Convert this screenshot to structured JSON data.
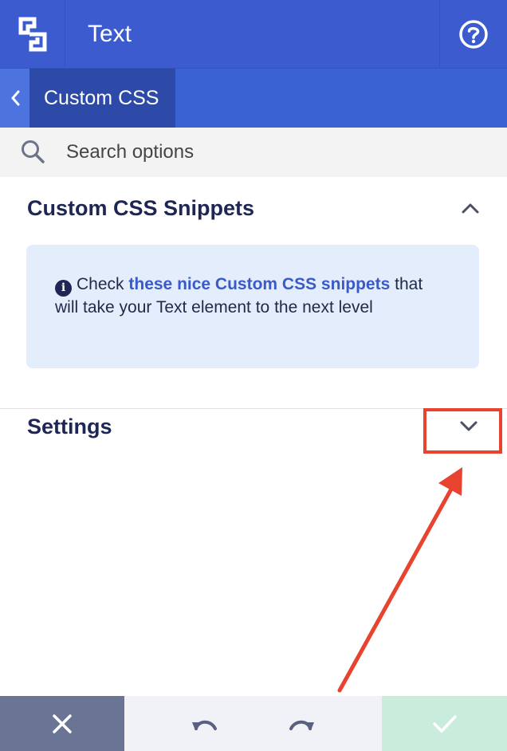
{
  "header": {
    "title": "Text",
    "logo_icon": "builder-logo-icon",
    "help_icon": "help-circle-icon"
  },
  "breadcrumb": {
    "back_icon": "chevron-left-icon",
    "current": "Custom CSS"
  },
  "search": {
    "placeholder": "Search options",
    "value": ""
  },
  "sections": {
    "snippets": {
      "title": "Custom CSS Snippets",
      "toggle_icon": "chevron-up-icon",
      "info": {
        "prefix": "Check",
        "link_text": "these nice Custom CSS snippets",
        "suffix": "that will take your Text element to the next level"
      }
    },
    "settings": {
      "title": "Settings",
      "toggle_icon": "chevron-down-icon"
    }
  },
  "footer": {
    "cancel_icon": "close-icon",
    "undo_icon": "undo-icon",
    "redo_icon": "redo-icon",
    "confirm_icon": "check-icon"
  },
  "colors": {
    "header_bg": "#3b5bce",
    "accent_link": "#3a5bc7",
    "annotation": "#e8432f"
  }
}
